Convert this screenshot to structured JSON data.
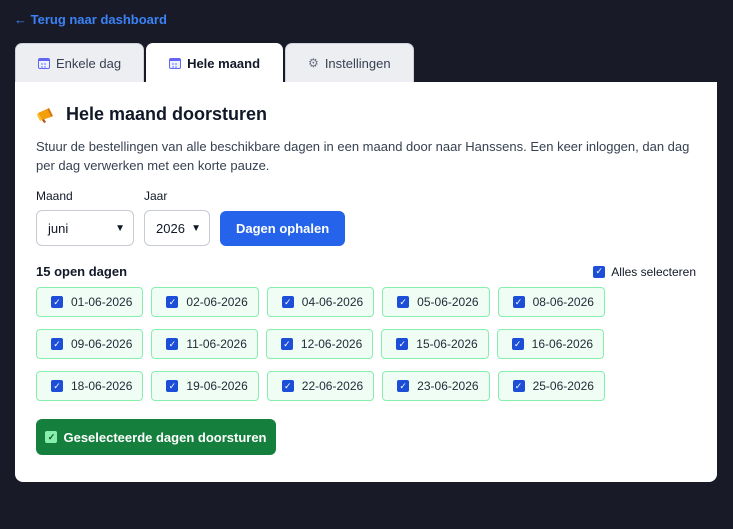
{
  "nav": {
    "back_label": "← Terug naar dashboard"
  },
  "tabs": [
    {
      "label": "Enkele dag",
      "icon": "calendar-icon"
    },
    {
      "label": "Hele maand",
      "icon": "calendar-icon",
      "active": true
    },
    {
      "label": "Instellingen",
      "icon": "gear-icon",
      "glyph": "⚙"
    }
  ],
  "panel": {
    "title": "Hele maand doorsturen",
    "title_icon": "megaphone-icon",
    "description": "Stuur de bestellingen van alle beschikbare dagen in een maand door naar Hanssens. Een keer inloggen, dan dag per dag verwerken met een korte pauze."
  },
  "form": {
    "month_label": "Maand",
    "month_value": "juni",
    "year_label": "Jaar",
    "year_value": "2026",
    "fetch_button": "Dagen ophalen"
  },
  "days": {
    "count_label": "15 open dagen",
    "select_all_label": "Alles selecteren",
    "select_all_checked": true,
    "items": [
      "01-06-2026",
      "02-06-2026",
      "04-06-2026",
      "05-06-2026",
      "08-06-2026",
      "09-06-2026",
      "11-06-2026",
      "12-06-2026",
      "15-06-2026",
      "16-06-2026",
      "18-06-2026",
      "19-06-2026",
      "22-06-2026",
      "23-06-2026",
      "25-06-2026"
    ]
  },
  "submit_button": "Geselecteerde dagen doorsturen",
  "colors": {
    "background": "#181b27",
    "link": "#3b82f6",
    "primary": "#2563eb",
    "success": "#15803d",
    "chip_bg": "#f0fdf4",
    "chip_border": "#86efac"
  }
}
